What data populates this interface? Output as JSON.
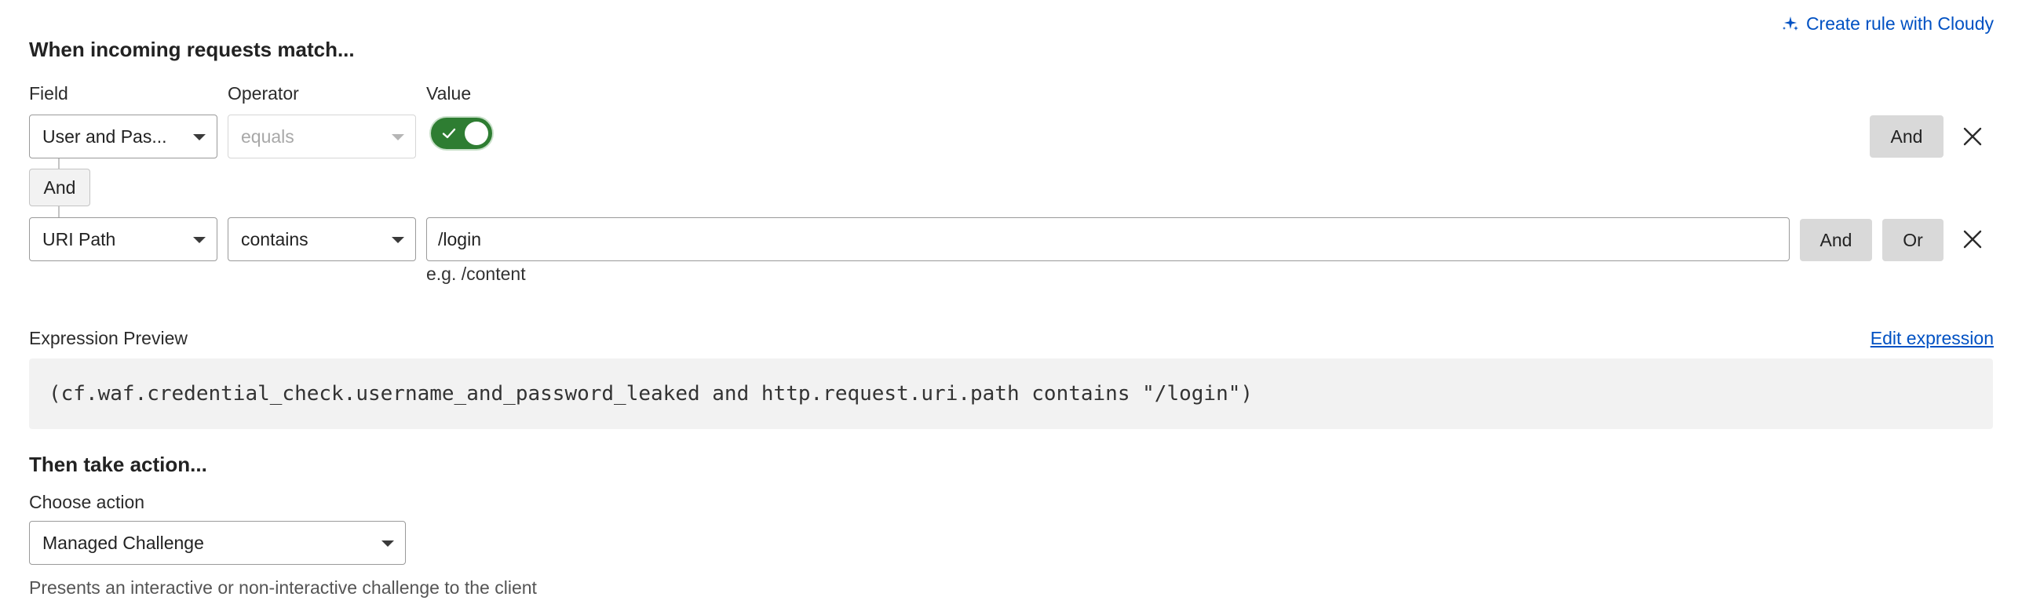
{
  "header": {
    "title": "When incoming requests match...",
    "cloudy_link": "Create rule with Cloudy",
    "cloudy_icon": "sparkle-icon"
  },
  "columns": {
    "field": "Field",
    "operator": "Operator",
    "value": "Value"
  },
  "rows": [
    {
      "field": "User and Pas...",
      "operator": "equals",
      "operator_disabled": true,
      "value_toggle": true,
      "and_label": "And"
    },
    {
      "field": "URI Path",
      "operator": "contains",
      "value": "/login",
      "value_hint": "e.g. /content",
      "and_label": "And",
      "or_label": "Or"
    }
  ],
  "joiner": "And",
  "expression": {
    "label": "Expression Preview",
    "edit_link": "Edit expression",
    "text": "(cf.waf.credential_check.username_and_password_leaked and http.request.uri.path contains \"/login\")"
  },
  "action": {
    "title": "Then take action...",
    "label": "Choose action",
    "selected": "Managed Challenge",
    "description": "Presents an interactive or non-interactive challenge to the client"
  },
  "colors": {
    "link": "#0051c3",
    "toggle_on": "#2e7d32",
    "button_bg": "#d9d9d9",
    "expression_bg": "#f2f2f2"
  }
}
